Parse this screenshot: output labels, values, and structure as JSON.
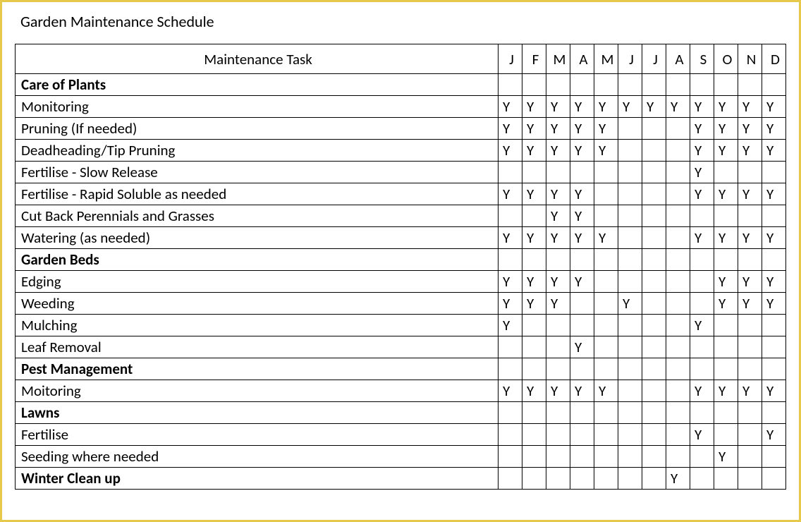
{
  "title": "Garden Maintenance Schedule",
  "columns": {
    "task": "Maintenance Task",
    "months": [
      "J",
      "F",
      "M",
      "A",
      "M",
      "J",
      "J",
      "A",
      "S",
      "O",
      "N",
      "D"
    ]
  },
  "rows": [
    {
      "type": "section",
      "label": "Care of Plants",
      "marks": [
        "",
        "",
        "",
        "",
        "",
        "",
        "",
        "",
        "",
        "",
        "",
        ""
      ]
    },
    {
      "type": "task",
      "label": "Monitoring",
      "marks": [
        "Y",
        "Y",
        "Y",
        "Y",
        "Y",
        "Y",
        "Y",
        "Y",
        "Y",
        "Y",
        "Y",
        "Y"
      ]
    },
    {
      "type": "task",
      "label": "Pruning (If needed)",
      "marks": [
        "Y",
        "Y",
        "Y",
        "Y",
        "Y",
        "",
        "",
        "",
        "Y",
        "Y",
        "Y",
        "Y"
      ]
    },
    {
      "type": "task",
      "label": "Deadheading/Tip Pruning",
      "marks": [
        "Y",
        "Y",
        "Y",
        "Y",
        "Y",
        "",
        "",
        "",
        "Y",
        "Y",
        "Y",
        "Y"
      ]
    },
    {
      "type": "task",
      "label": "Fertilise - Slow Release",
      "marks": [
        "",
        "",
        "",
        "",
        "",
        "",
        "",
        "",
        "Y",
        "",
        "",
        ""
      ]
    },
    {
      "type": "task",
      "label": "Fertilise - Rapid Soluble as needed",
      "marks": [
        "Y",
        "Y",
        "Y",
        "Y",
        "",
        "",
        "",
        "",
        "Y",
        "Y",
        "Y",
        "Y"
      ]
    },
    {
      "type": "task",
      "label": "Cut Back Perennials and Grasses",
      "marks": [
        "",
        "",
        "Y",
        "Y",
        "",
        "",
        "",
        "",
        "",
        "",
        "",
        ""
      ]
    },
    {
      "type": "task",
      "label": "Watering (as needed)",
      "marks": [
        "Y",
        "Y",
        "Y",
        "Y",
        "Y",
        "",
        "",
        "",
        "Y",
        "Y",
        "Y",
        "Y"
      ]
    },
    {
      "type": "section",
      "label": "Garden Beds",
      "marks": [
        "",
        "",
        "",
        "",
        "",
        "",
        "",
        "",
        "",
        "",
        "",
        ""
      ]
    },
    {
      "type": "task",
      "label": "Edging",
      "marks": [
        "Y",
        "Y",
        "Y",
        "Y",
        "",
        "",
        "",
        "",
        "",
        "Y",
        "Y",
        "Y"
      ]
    },
    {
      "type": "task",
      "label": "Weeding",
      "marks": [
        "Y",
        "Y",
        "Y",
        "",
        "",
        "Y",
        "",
        "",
        "",
        "Y",
        "Y",
        "Y"
      ]
    },
    {
      "type": "task",
      "label": "Mulching",
      "marks": [
        "Y",
        "",
        "",
        "",
        "",
        "",
        "",
        "",
        "Y",
        "",
        "",
        ""
      ]
    },
    {
      "type": "task",
      "label": "Leaf Removal",
      "marks": [
        "",
        "",
        "",
        "Y",
        "",
        "",
        "",
        "",
        "",
        "",
        "",
        ""
      ]
    },
    {
      "type": "section",
      "label": "Pest Management",
      "marks": [
        "",
        "",
        "",
        "",
        "",
        "",
        "",
        "",
        "",
        "",
        "",
        ""
      ]
    },
    {
      "type": "task",
      "label": "Moitoring",
      "marks": [
        "Y",
        "Y",
        "Y",
        "Y",
        "Y",
        "",
        "",
        "",
        "Y",
        "Y",
        "Y",
        "Y"
      ]
    },
    {
      "type": "section",
      "label": "Lawns",
      "marks": [
        "",
        "",
        "",
        "",
        "",
        "",
        "",
        "",
        "",
        "",
        "",
        ""
      ]
    },
    {
      "type": "task",
      "label": "Fertilise",
      "marks": [
        "",
        "",
        "",
        "",
        "",
        "",
        "",
        "",
        "Y",
        "",
        "",
        "Y"
      ]
    },
    {
      "type": "task",
      "label": "Seeding where needed",
      "marks": [
        "",
        "",
        "",
        "",
        "",
        "",
        "",
        "",
        "",
        "Y",
        "",
        ""
      ]
    },
    {
      "type": "section",
      "label": "Winter Clean up",
      "marks": [
        "",
        "",
        "",
        "",
        "",
        "",
        "",
        "Y",
        "",
        "",
        "",
        ""
      ]
    }
  ]
}
